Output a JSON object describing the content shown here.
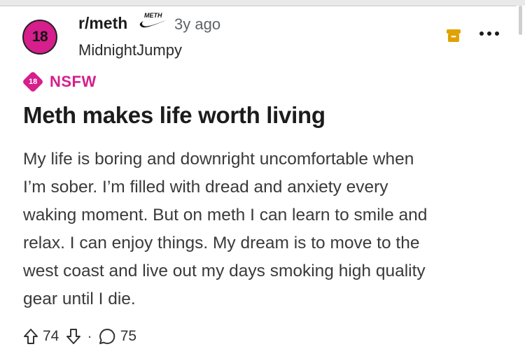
{
  "post": {
    "subreddit": "r/meth",
    "flair_logo_text": "METH",
    "time_ago": "3y ago",
    "author": "MidnightJumpy",
    "avatar_text": "18",
    "nsfw_badge_text": "18",
    "nsfw_label": "NSFW",
    "title": "Meth makes life worth living",
    "body_lines": [
      "My life is boring and downright uncomfortable when",
      "I’m sober. I’m filled with dread and anxiety every",
      "waking moment. But on meth I can learn to smile and",
      "relax. I can enjoy things. My dream is to move to the",
      "west coast and live out my days smoking high quality",
      "gear until I die."
    ],
    "upvotes": "74",
    "separator": "·",
    "comments": "75"
  },
  "colors": {
    "nsfw_pink": "#d61e8c",
    "archive_yellow": "#e1a100"
  },
  "icons": {
    "archive": "archive-icon",
    "more": "more-icon",
    "upvote": "upvote-icon",
    "downvote": "downvote-icon",
    "comment": "comment-icon"
  }
}
